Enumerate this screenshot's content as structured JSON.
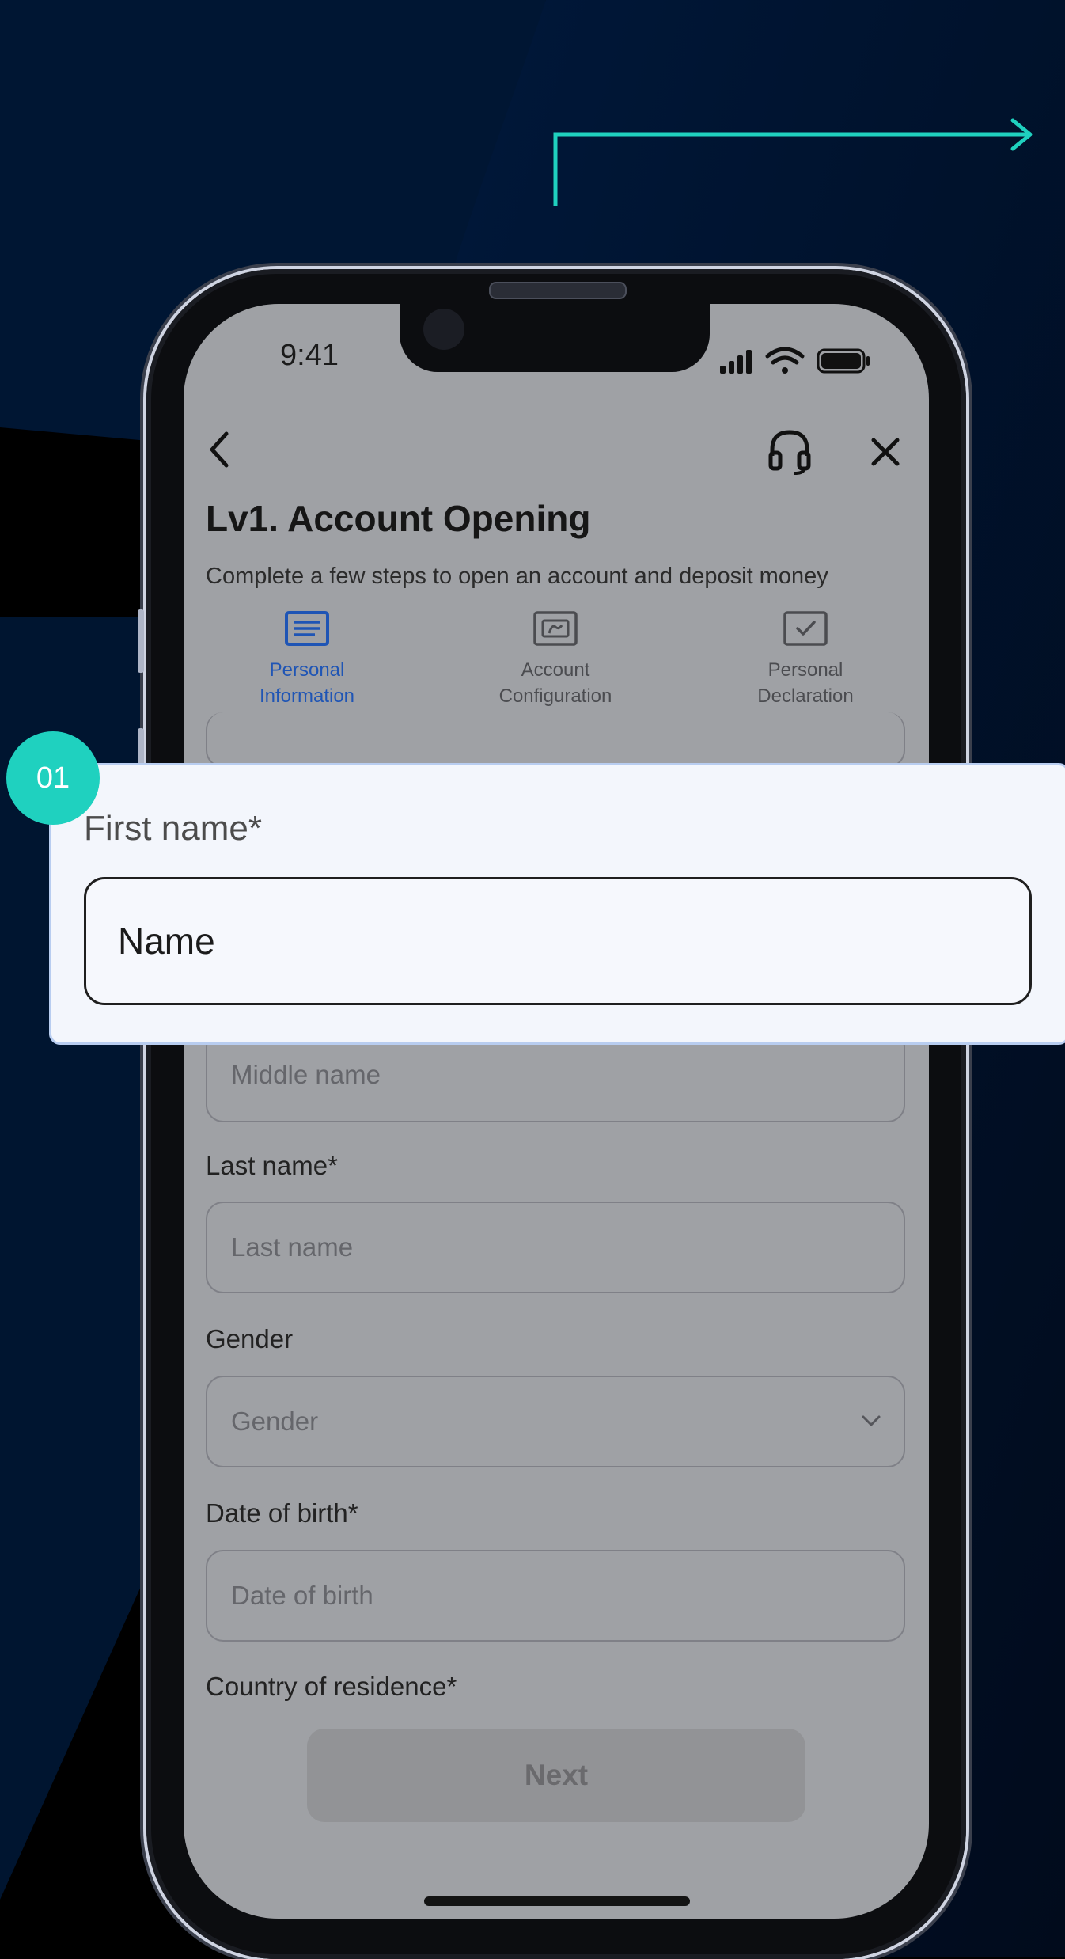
{
  "status_bar": {
    "time": "9:41"
  },
  "header": {
    "title": "Lv1. Account Opening",
    "subtitle": "Complete a few steps to open an account and deposit money"
  },
  "steps": [
    {
      "line1": "Personal",
      "line2": "Information",
      "state": "active",
      "icon": "form-list-icon"
    },
    {
      "line1": "Account",
      "line2": "Configuration",
      "state": "inactive",
      "icon": "id-card-icon"
    },
    {
      "line1": "Personal",
      "line2": "Declaration",
      "state": "inactive",
      "icon": "checkbox-icon"
    }
  ],
  "form": {
    "middle_name": {
      "placeholder": "Middle name"
    },
    "last_name": {
      "label": "Last name*",
      "placeholder": "Last name"
    },
    "gender": {
      "label": "Gender",
      "placeholder": "Gender"
    },
    "dob": {
      "label": "Date of birth*",
      "placeholder": "Date of birth"
    },
    "country": {
      "label": "Country of residence*"
    },
    "next_label": "Next"
  },
  "callout": {
    "badge": "01",
    "label": "First name*",
    "value": "Name"
  },
  "colors": {
    "accent_teal": "#1fd1bf",
    "active_step": "#1f55b5",
    "background_navy": "#00132f"
  }
}
